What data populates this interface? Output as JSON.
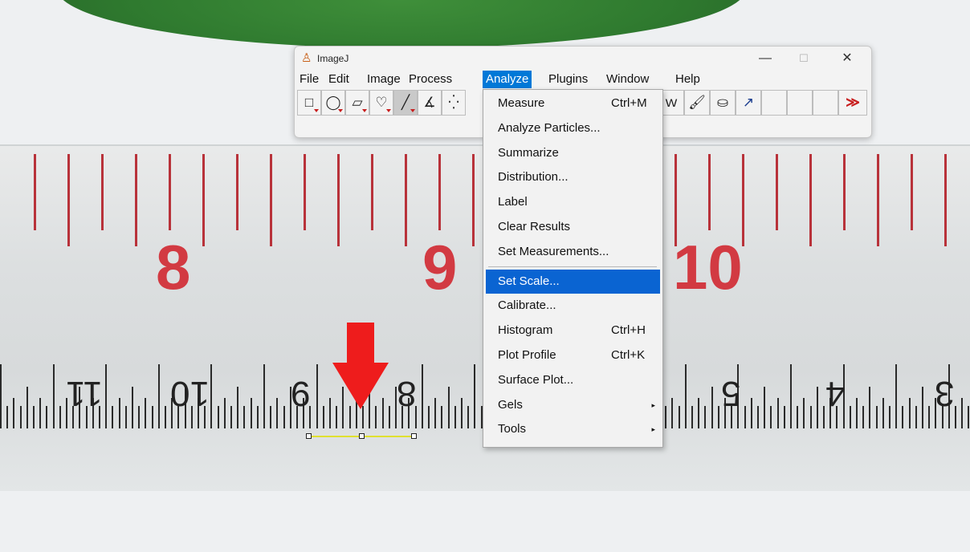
{
  "window": {
    "title": "ImageJ",
    "controls": {
      "minimize": "—",
      "maximize": "☐",
      "close": "✕"
    }
  },
  "menubar": [
    {
      "label": "File"
    },
    {
      "label": "Edit"
    },
    {
      "label": "Image"
    },
    {
      "label": "Process"
    },
    {
      "label": "Analyze",
      "active": true
    },
    {
      "label": "Plugins"
    },
    {
      "label": "Window"
    },
    {
      "label": "Help"
    }
  ],
  "toolbar": {
    "tools": [
      {
        "name": "rectangle-tool",
        "glyph": "□"
      },
      {
        "name": "oval-tool",
        "glyph": "◯"
      },
      {
        "name": "polygon-tool",
        "glyph": "▱"
      },
      {
        "name": "freehand-tool",
        "glyph": "♡"
      },
      {
        "name": "line-tool",
        "glyph": "╱",
        "selected": true
      },
      {
        "name": "angle-tool",
        "glyph": "∡"
      },
      {
        "name": "point-tool",
        "glyph": "⁛"
      }
    ],
    "right_tools": [
      {
        "name": "magic-wand-tool",
        "glyph": "ｗ"
      },
      {
        "name": "brush-tool",
        "glyph": "🖌"
      },
      {
        "name": "flood-fill-tool",
        "glyph": "⛀"
      },
      {
        "name": "arrow-tool",
        "glyph": "↗"
      },
      {
        "name": "empty-slot-1",
        "glyph": ""
      },
      {
        "name": "empty-slot-2",
        "glyph": ""
      },
      {
        "name": "empty-slot-3",
        "glyph": ""
      },
      {
        "name": "more-tools",
        "glyph": "≫"
      }
    ]
  },
  "analyze_menu": [
    {
      "label": "Measure",
      "shortcut": "Ctrl+M"
    },
    {
      "label": "Analyze Particles..."
    },
    {
      "label": "Summarize"
    },
    {
      "label": "Distribution..."
    },
    {
      "label": "Label"
    },
    {
      "label": "Clear Results"
    },
    {
      "label": "Set Measurements..."
    },
    {
      "label": "Set Scale...",
      "highlighted": true
    },
    {
      "label": "Calibrate..."
    },
    {
      "label": "Histogram",
      "shortcut": "Ctrl+H"
    },
    {
      "label": "Plot Profile",
      "shortcut": "Ctrl+K"
    },
    {
      "label": "Surface Plot..."
    },
    {
      "label": "Gels",
      "submenu": "▸"
    },
    {
      "label": "Tools",
      "submenu": "▸"
    }
  ],
  "ruler": {
    "metric_numbers": [
      "8",
      "9",
      "10"
    ],
    "inch_numbers": [
      "11",
      "10",
      "9",
      "8",
      "5",
      "4",
      "3"
    ]
  },
  "colors": {
    "menu_highlight": "#0078d7",
    "red_arrow": "#ee1c1c",
    "measure_line": "#e0e030",
    "ruler_red": "#d23a42"
  }
}
